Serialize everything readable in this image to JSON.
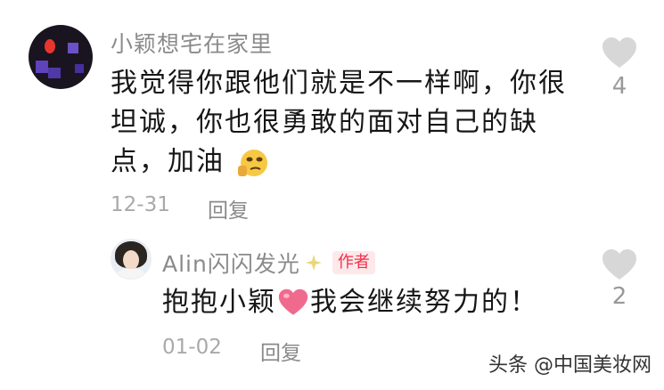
{
  "comment": {
    "username": "小颖想宅在家里",
    "text_line1": "我觉得你跟他们就是不一样啊，你很",
    "text_line2": "坦诚，你也很勇敢的面对自己的缺",
    "text_line3": "点，加油",
    "emoji": "thinking-face-icon",
    "date": "12-31",
    "reply_label": "回复",
    "likes": "4"
  },
  "reply": {
    "username": "Alin闪闪发光",
    "badge": "作者",
    "text_before": "抱抱小颖",
    "emoji": "pink-heart-icon",
    "text_after": "我会继续努力的！",
    "date": "01-02",
    "reply_label": "回复",
    "likes": "2"
  },
  "watermark": "头条 @中国美妆网",
  "colors": {
    "heart_gray": "#d7d7d7",
    "badge_red": "#f0314b",
    "badge_bg": "#fde8ea",
    "heart_pink": "#f06a8e"
  }
}
